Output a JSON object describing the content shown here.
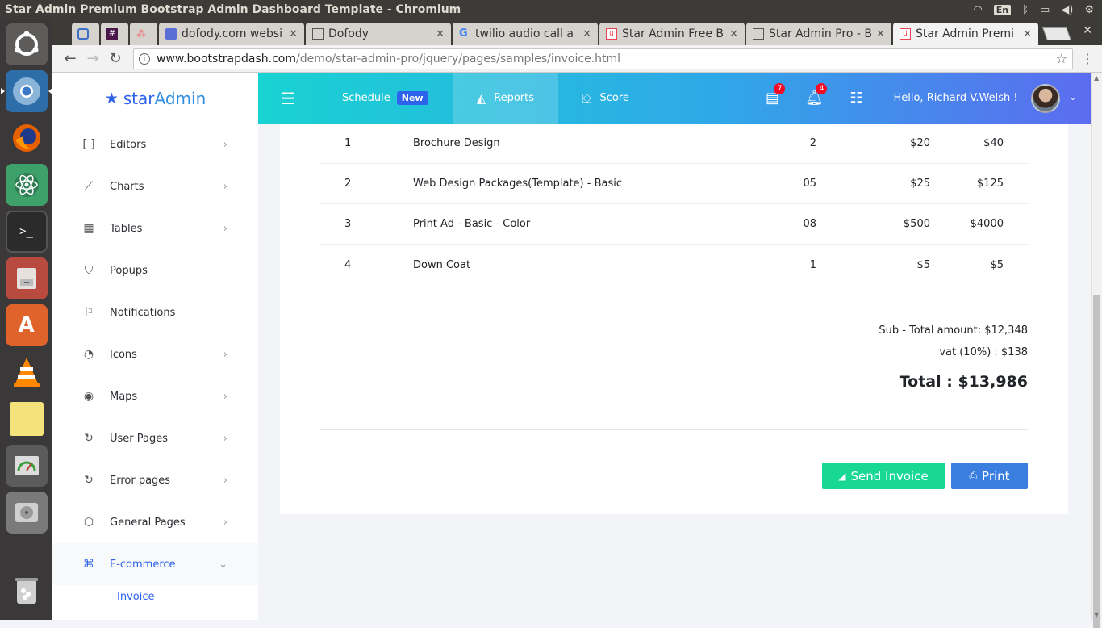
{
  "window": {
    "title": "Star Admin Premium Bootstrap Admin Dashboard Template - Chromium",
    "lang": "En"
  },
  "tabs": [
    {
      "label": "",
      "icon": "mail-icon"
    },
    {
      "label": "",
      "icon": "slack-icon"
    },
    {
      "label": "",
      "icon": "asana-icon"
    },
    {
      "label": "dofody.com websi",
      "icon": "doc-icon"
    },
    {
      "label": "Dofody",
      "icon": "page-icon"
    },
    {
      "label": "twilio audio call a",
      "icon": "google-icon"
    },
    {
      "label": "Star Admin Free B",
      "icon": "star-admin-icon"
    },
    {
      "label": "Star Admin Pro - B",
      "icon": "page-icon"
    },
    {
      "label": "Star Admin Premi",
      "icon": "star-admin-icon"
    }
  ],
  "url": {
    "host": "www.bootstrapdash.com",
    "path": "/demo/star-admin-pro/jquery/pages/samples/invoice.html"
  },
  "brand": {
    "part1": "star",
    "part2": "Admin"
  },
  "sidebar": {
    "items": [
      {
        "label": "Editors",
        "icon": "bracket-icon",
        "glyph": "[ ]"
      },
      {
        "label": "Charts",
        "icon": "line-chart-icon",
        "glyph": "⟋"
      },
      {
        "label": "Tables",
        "icon": "table-icon",
        "glyph": "▦"
      },
      {
        "label": "Popups",
        "icon": "shield-icon",
        "glyph": "⛉"
      },
      {
        "label": "Notifications",
        "icon": "flag-icon",
        "glyph": "⚐"
      },
      {
        "label": "Icons",
        "icon": "palette-icon",
        "glyph": "◔"
      },
      {
        "label": "Maps",
        "icon": "map-pin-icon",
        "glyph": "◉"
      },
      {
        "label": "User Pages",
        "icon": "refresh-icon",
        "glyph": "↻"
      },
      {
        "label": "Error pages",
        "icon": "refresh-icon",
        "glyph": "↻"
      },
      {
        "label": "General Pages",
        "icon": "box-icon",
        "glyph": "⬡"
      },
      {
        "label": "E-commerce",
        "icon": "command-icon",
        "glyph": "⌘"
      }
    ],
    "sub_item": "Invoice"
  },
  "topnav": {
    "schedule": "Schedule",
    "new_badge": "New",
    "reports": "Reports",
    "score": "Score",
    "messages_count": "7",
    "notifications_count": "4",
    "greeting": "Hello, Richard V.Welsh !"
  },
  "invoice": {
    "rows": [
      {
        "num": "1",
        "description": "Brochure Design",
        "qty": "2",
        "unit": "$20",
        "total": "$40"
      },
      {
        "num": "2",
        "description": "Web Design Packages(Template) - Basic",
        "qty": "05",
        "unit": "$25",
        "total": "$125"
      },
      {
        "num": "3",
        "description": "Print Ad - Basic - Color",
        "qty": "08",
        "unit": "$500",
        "total": "$4000"
      },
      {
        "num": "4",
        "description": "Down Coat",
        "qty": "1",
        "unit": "$5",
        "total": "$5"
      }
    ],
    "subtotal": "Sub - Total amount: $12,348",
    "vat": "vat (10%) : $138",
    "total": "Total : $13,986",
    "send_label": "Send Invoice",
    "print_label": "Print"
  },
  "colors": {
    "accent": "#2d62ed",
    "send": "#19d895",
    "print": "#3a7ee0",
    "badge": "#f50a25"
  }
}
